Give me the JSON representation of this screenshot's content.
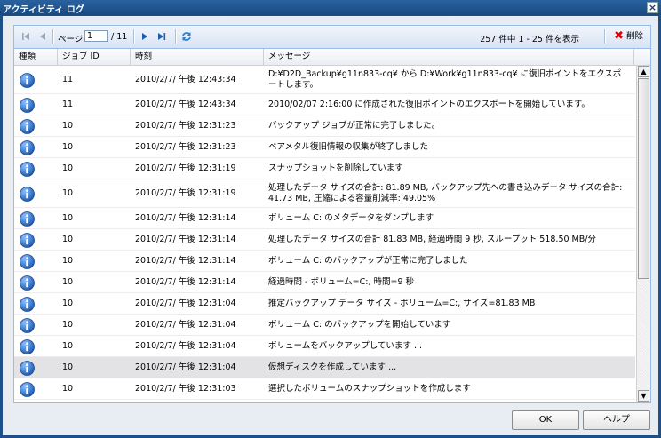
{
  "window": {
    "title": "アクティビティ ログ",
    "close": "×"
  },
  "toolbar": {
    "page_label": "ページ",
    "page_value": "1",
    "page_total": "/ 11",
    "info": "257 件中 1 - 25 件を表示",
    "delete_label": "削除"
  },
  "columns": {
    "type": "種類",
    "job_id": "ジョブ ID",
    "time": "時刻",
    "message": "メッセージ"
  },
  "rows": [
    {
      "job": "11",
      "time": "2010/2/7/ 午後 12:43:34",
      "msg": "D:¥D2D_Backup¥g11n833-cq¥ から D:¥Work¥g11n833-cq¥ に復旧ポイントをエクスポートします。",
      "tall": true
    },
    {
      "job": "11",
      "time": "2010/2/7/ 午後 12:43:34",
      "msg": "2010/02/07 2:16:00 に作成された復旧ポイントのエクスポートを開始しています。"
    },
    {
      "job": "10",
      "time": "2010/2/7/ 午後 12:31:23",
      "msg": "バックアップ ジョブが正常に完了しました。"
    },
    {
      "job": "10",
      "time": "2010/2/7/ 午後 12:31:23",
      "msg": "ベアメタル復旧情報の収集が終了しました"
    },
    {
      "job": "10",
      "time": "2010/2/7/ 午後 12:31:19",
      "msg": "スナップショットを削除しています"
    },
    {
      "job": "10",
      "time": "2010/2/7/ 午後 12:31:19",
      "msg": "処理したデータ サイズの合計: 81.89 MB, バックアップ先への書き込みデータ サイズの合計: 41.73 MB, 圧縮による容量削減率: 49.05%",
      "tall": true
    },
    {
      "job": "10",
      "time": "2010/2/7/ 午後 12:31:14",
      "msg": "ボリューム C: のメタデータをダンプします"
    },
    {
      "job": "10",
      "time": "2010/2/7/ 午後 12:31:14",
      "msg": "処理したデータ サイズの合計 81.83 MB, 経過時間 9 秒, スループット 518.50 MB/分"
    },
    {
      "job": "10",
      "time": "2010/2/7/ 午後 12:31:14",
      "msg": "ボリューム C: のバックアップが正常に完了しました"
    },
    {
      "job": "10",
      "time": "2010/2/7/ 午後 12:31:14",
      "msg": "経過時間 - ボリューム=C:, 時間=9 秒"
    },
    {
      "job": "10",
      "time": "2010/2/7/ 午後 12:31:04",
      "msg": "推定バックアップ データ サイズ - ボリューム=C:, サイズ=81.83 MB"
    },
    {
      "job": "10",
      "time": "2010/2/7/ 午後 12:31:04",
      "msg": "ボリューム C: のバックアップを開始しています"
    },
    {
      "job": "10",
      "time": "2010/2/7/ 午後 12:31:04",
      "msg": "ボリュームをバックアップしています ..."
    },
    {
      "job": "10",
      "time": "2010/2/7/ 午後 12:31:04",
      "msg": "仮想ディスクを作成しています ...",
      "selected": true
    },
    {
      "job": "10",
      "time": "2010/2/7/ 午後 12:31:03",
      "msg": "選択したボリュームのスナップショットを作成します"
    }
  ],
  "buttons": {
    "ok": "OK",
    "help": "ヘルプ"
  },
  "colors": {
    "title_bar": "#1d5088",
    "info_icon": "#1f5db4",
    "delete_icon": "#dd0000"
  }
}
